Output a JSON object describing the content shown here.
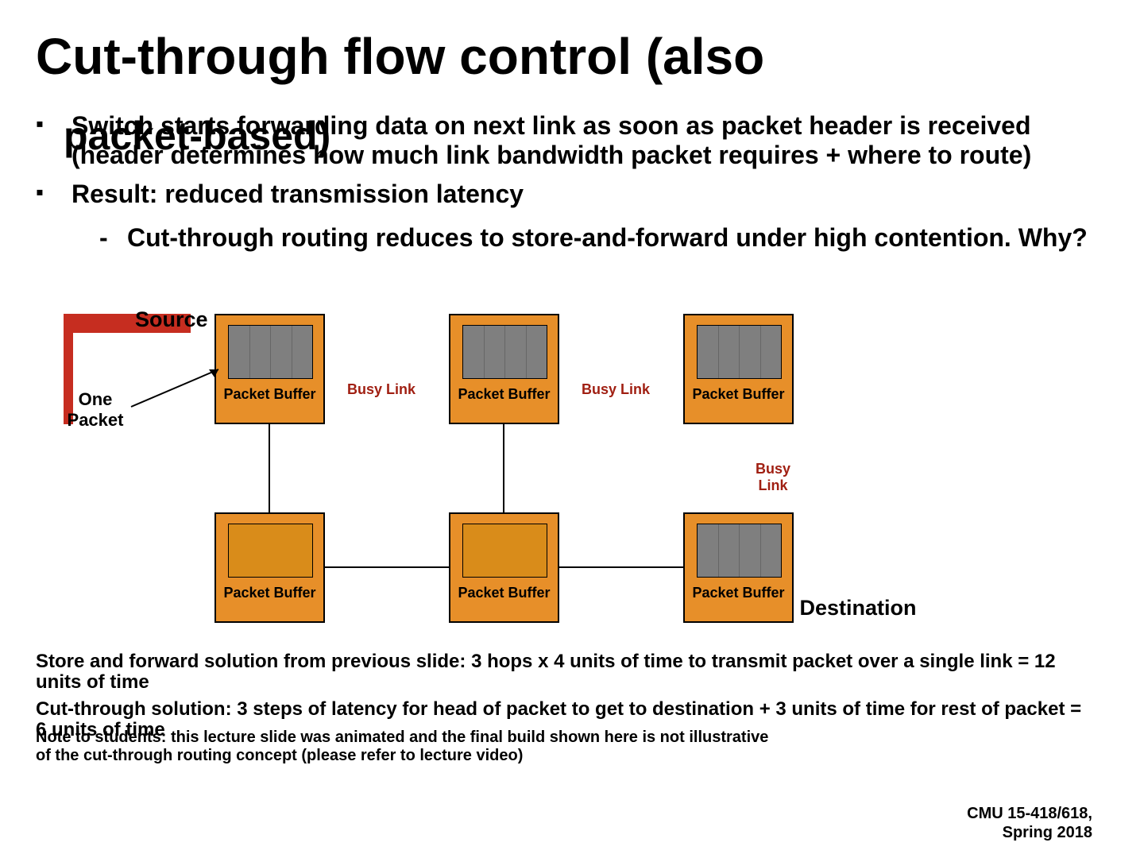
{
  "title": "Cut-through flow control (also",
  "title2": "packet-based)",
  "bullets": {
    "b1": "Switch starts forwarding data on next link as soon as packet header is received (header determines how much link bandwidth packet requires + where to route)",
    "b2": "Result: reduced transmission latency",
    "sub1": "Cut-through routing reduces to store-and-forward under high contention.  Why?"
  },
  "diagram": {
    "nodeLabel": "Packet Buffer",
    "source": "Source",
    "onePacket": "One Packet",
    "destination": "Destination",
    "busyLink": "Busy Link",
    "busyLinkStacked": "Busy Link"
  },
  "bottom1": "Store and forward solution from previous slide: 3 hops x 4 units of time to transmit packet over a single link = 12 units of time",
  "bottom2": "Cut-through solution: 3 steps of latency for head of packet to get to destination + 3 units of time for rest of packet = 6 units of time",
  "note": "Note to students: this lecture slide was animated and the final build shown here is not illustrative of the cut-through routing concept (please refer to lecture video)",
  "footer1": "CMU 15-418/618,",
  "footer2": "Spring 2018"
}
